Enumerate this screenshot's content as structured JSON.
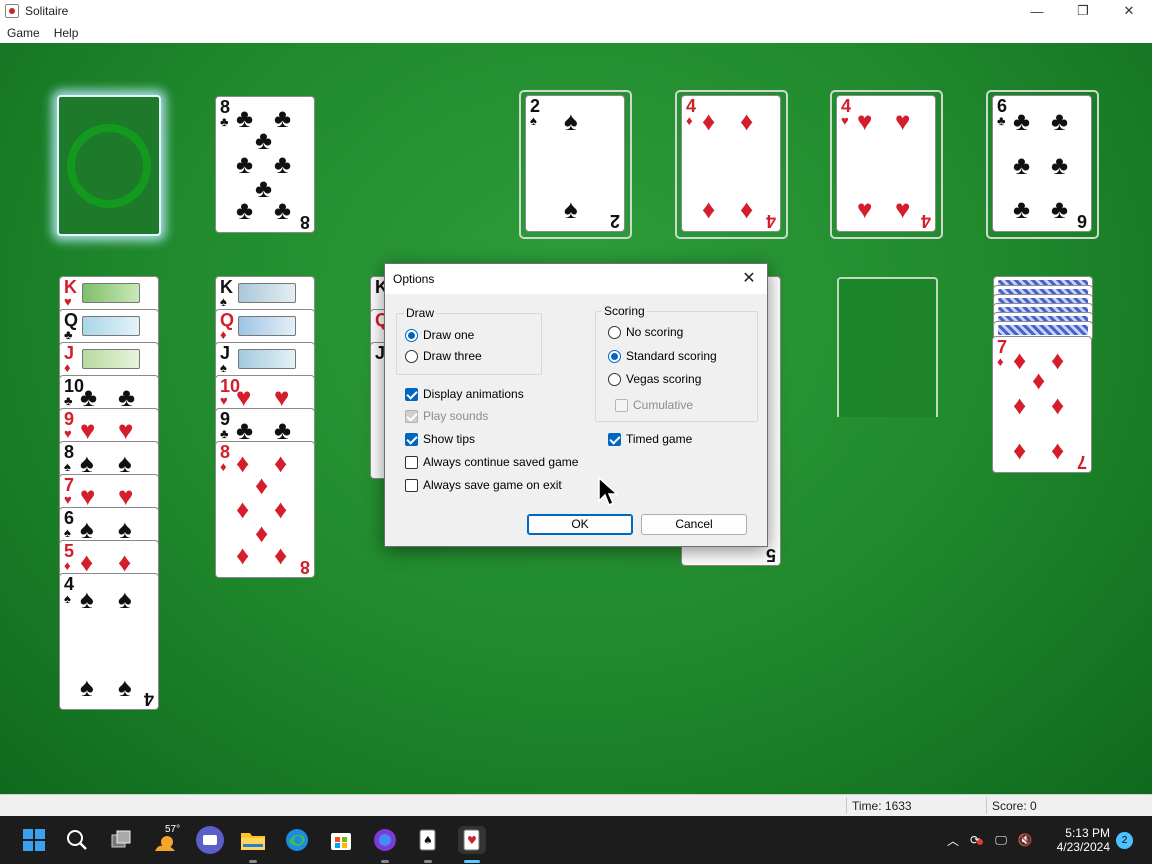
{
  "window": {
    "title": "Solitaire",
    "controls": [
      "—",
      "❐",
      "✕"
    ]
  },
  "menu": {
    "items": [
      "Game",
      "Help"
    ]
  },
  "game": {
    "waste_card": {
      "rank": "8",
      "suit": "♣",
      "color": "black"
    },
    "foundations": [
      {
        "rank": "2",
        "suit": "♠",
        "color": "black"
      },
      {
        "rank": "4",
        "suit": "♦",
        "color": "red"
      },
      {
        "rank": "4",
        "suit": "♥",
        "color": "red"
      },
      {
        "rank": "6",
        "suit": "♣",
        "color": "black"
      }
    ],
    "column1_ranks": [
      "K",
      "Q",
      "J",
      "10",
      "9",
      "8",
      "7",
      "6",
      "5"
    ],
    "column1_last": {
      "rank": "4",
      "suit": "♠"
    },
    "column2_ranks": [
      "K",
      "Q",
      "J",
      "10",
      "9"
    ],
    "column2_last": {
      "rank": "8",
      "suit": "♦"
    },
    "column3_ranks": [
      "K",
      "Q",
      "J"
    ],
    "column5_bottom_rank": "5",
    "column7_last": {
      "rank": "7",
      "suit": "♦"
    }
  },
  "dialog": {
    "title": "Options",
    "draw": {
      "label": "Draw",
      "options": [
        {
          "label": "Draw one",
          "selected": true
        },
        {
          "label": "Draw three",
          "selected": false
        }
      ]
    },
    "scoring": {
      "label": "Scoring",
      "options": [
        {
          "label": "No scoring",
          "selected": false
        },
        {
          "label": "Standard scoring",
          "selected": true
        },
        {
          "label": "Vegas scoring",
          "selected": false
        }
      ],
      "cumulative": "Cumulative"
    },
    "checks": {
      "display_animations": "Display animations",
      "play_sounds": "Play sounds",
      "show_tips": "Show tips",
      "always_continue": "Always continue saved game",
      "always_save": "Always save game on exit",
      "timed_game": "Timed game"
    },
    "ok": "OK",
    "cancel": "Cancel"
  },
  "status": {
    "time": "Time: 1633",
    "score": "Score: 0"
  },
  "taskbar": {
    "weather": "57°",
    "time": "5:13 PM",
    "date": "4/23/2024",
    "notifications": "2"
  }
}
